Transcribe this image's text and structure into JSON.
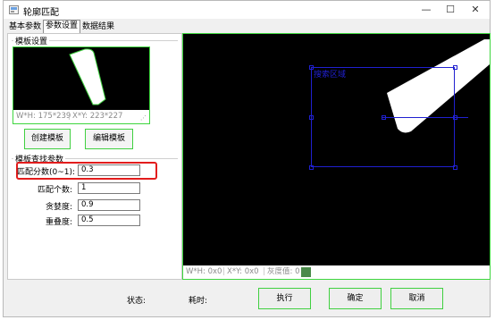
{
  "window": {
    "title": "轮廓匹配",
    "minimize": "—",
    "maximize": "☐",
    "close": "✕"
  },
  "tabs": [
    {
      "label": "基本参数",
      "active": false
    },
    {
      "label": "参数设置",
      "active": true
    },
    {
      "label": "数据结果",
      "active": false
    }
  ],
  "template_settings": {
    "group_label": "模板设置",
    "preview_status": {
      "wh": "W*H:  175*239",
      "xy": "X*Y:  223*227"
    },
    "create_button": "创建模板",
    "edit_button": "编辑模板"
  },
  "search_params": {
    "group_label": "模板查找参数",
    "fields": [
      {
        "label": "匹配分数(0~1):",
        "value": "0.3"
      },
      {
        "label": "匹配个数:",
        "value": "1"
      },
      {
        "label": "贪婪度:",
        "value": "0.9"
      },
      {
        "label": "重叠度:",
        "value": "0.5"
      }
    ]
  },
  "main_view": {
    "roi_label": "搜索区域",
    "status": {
      "wh": "W*H:  0x0",
      "xy": "X*Y:  0x0",
      "gray": "灰度值:  0"
    }
  },
  "bottom": {
    "status_label": "状态:",
    "time_label": "耗时:",
    "run_button": "执行",
    "ok_button": "确定",
    "cancel_button": "取消"
  },
  "colors": {
    "accent_green": "#40d040",
    "roi_blue": "#2020d0",
    "highlight_red": "#e21c1c"
  }
}
